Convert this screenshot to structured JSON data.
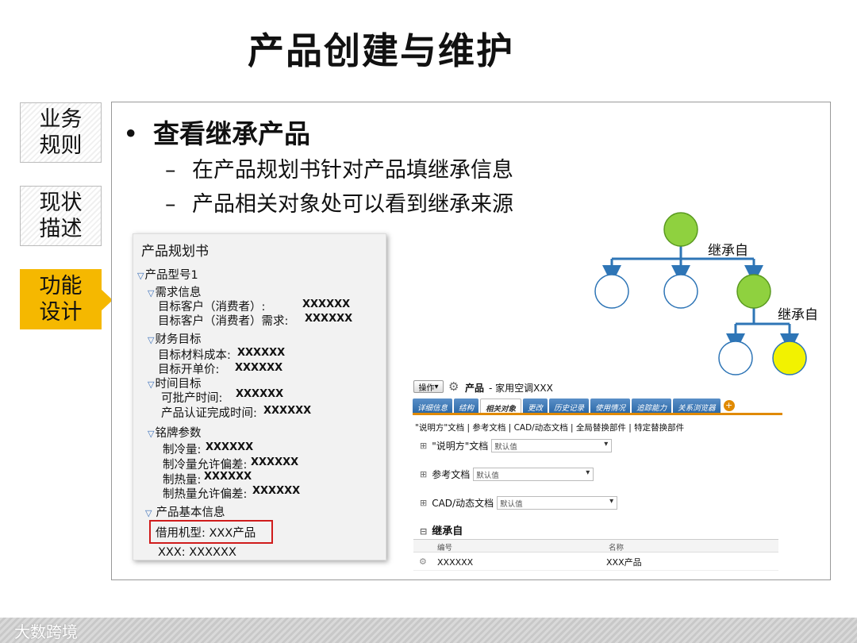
{
  "title": "产品创建与维护",
  "side_tabs": [
    {
      "label": "业务规则"
    },
    {
      "label": "现状描述"
    },
    {
      "label": "功能设计"
    }
  ],
  "main_bullet": "查看继承产品",
  "sub_bullets": [
    "在产品规划书针对产品填继承信息",
    "产品相关对象处可以看到继承来源"
  ],
  "tree_labels": {
    "inherit_top": "继承自",
    "inherit_bottom": "继承自"
  },
  "colors": {
    "accent_yellow": "#f5b800",
    "node_green": "#8fd13f",
    "node_yellow": "#f2f200",
    "tree_blue": "#2e75b6",
    "highlight_red": "#d01c1c"
  },
  "panel": {
    "title": "产品规划书",
    "model": "产品型号1",
    "sec_req": "需求信息",
    "target_customer": "目标客户（消费者）:",
    "target_customer_val": "XXXXXX",
    "target_customer_req": "目标客户（消费者）需求:",
    "target_customer_req_val": "XXXXXX",
    "sec_fin": "财务目标",
    "material_cost": "目标材料成本:",
    "material_cost_val": "XXXXXX",
    "unit_price": "目标开单价:",
    "unit_price_val": "XXXXXX",
    "sec_time": "时间目标",
    "batch_time": "可批产时间:",
    "batch_time_val": "XXXXXX",
    "cert_time": "产品认证完成时间:",
    "cert_time_val": "XXXXXX",
    "sec_plate": "铭牌参数",
    "cooling": "制冷量:",
    "cooling_val": "XXXXXX",
    "cooling_dev": "制冷量允许偏差:",
    "cooling_dev_val": "XXXXXX",
    "heating": "制热量:",
    "heating_val": "XXXXXX",
    "heating_dev": "制热量允许偏差:",
    "heating_dev_val": "XXXXXX",
    "sec_basic": "产品基本信息",
    "borrowed_model": "借用机型:  XXX产品",
    "xxx_line": "XXX:   XXXXXX"
  },
  "plm": {
    "op_button": "操作",
    "product_label": "产品",
    "product_name": "- 家用空调XXX",
    "tabs": [
      "详细信息",
      "结构",
      "相关对象",
      "更改",
      "历史记录",
      "使用情况",
      "追踪能力",
      "关系浏览器"
    ],
    "active_tab": 2,
    "tab_plus": "+",
    "sublinks": "\"说明方\"文档 | 参考文档 | CAD/动态文档 | 全局替换部件 | 特定替换部件",
    "rows": [
      {
        "label": "\"说明方\"文档",
        "value": "默认值"
      },
      {
        "label": "参考文档",
        "value": "默认值"
      },
      {
        "label": "CAD/动态文档",
        "value": "默认值"
      }
    ],
    "inherit_section": "继承自",
    "grid_cols": [
      "编号",
      "名称"
    ],
    "grid_row": [
      "XXXXXX",
      "XXX产品"
    ]
  },
  "watermark": "大数跨境"
}
